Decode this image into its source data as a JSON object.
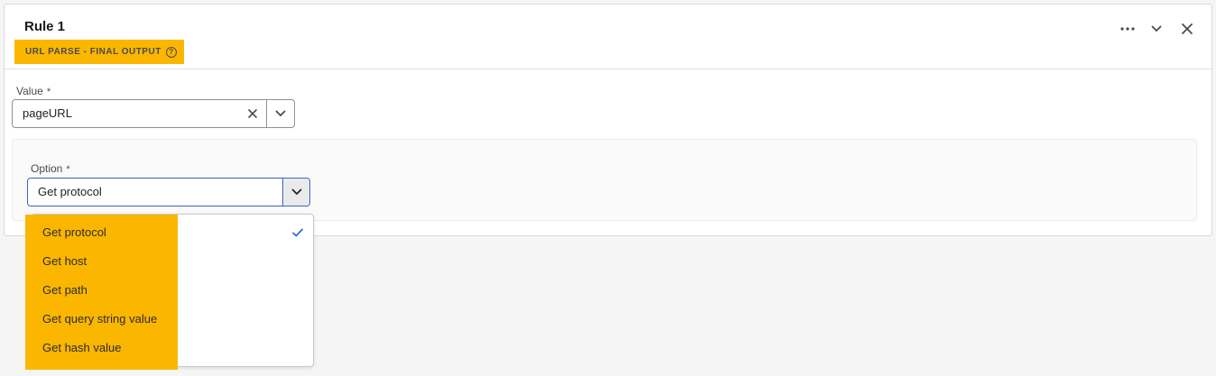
{
  "header": {
    "title": "Rule 1",
    "tag_label": "URL PARSE - FINAL OUTPUT",
    "help_glyph": "?",
    "accent_color": "#fbb600",
    "icons": [
      "more-icon",
      "chevron-down-icon",
      "close-icon"
    ]
  },
  "value_field": {
    "label": "Value",
    "required_mark": "*",
    "value": "pageURL"
  },
  "option_field": {
    "label": "Option",
    "required_mark": "*",
    "selected": "Get protocol",
    "focus_color": "#3b63c4"
  },
  "menu": {
    "items": [
      {
        "label": "Get protocol",
        "selected": true
      },
      {
        "label": "Get host",
        "selected": false
      },
      {
        "label": "Get path",
        "selected": false
      },
      {
        "label": "Get query string value",
        "selected": false
      },
      {
        "label": "Get hash value",
        "selected": false
      }
    ],
    "check_color": "#2d6fdb"
  }
}
